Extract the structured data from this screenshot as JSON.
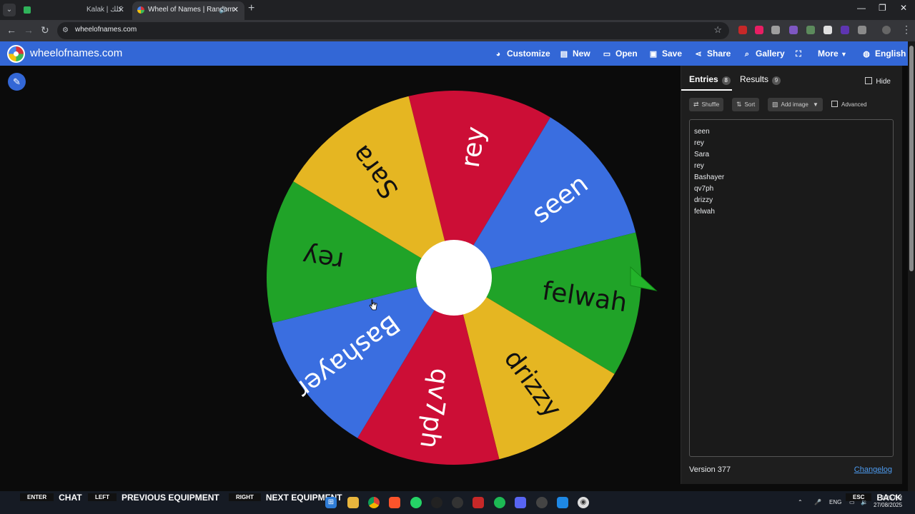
{
  "browser": {
    "tabs": [
      {
        "title": "Kalak | كلك",
        "active": false
      },
      {
        "title": "Wheel of Names | Random",
        "active": true
      }
    ],
    "url": "wheelofnames.com"
  },
  "header": {
    "site_name": "wheelofnames.com",
    "menu": {
      "customize": "Customize",
      "new": "New",
      "open": "Open",
      "save": "Save",
      "share": "Share",
      "gallery": "Gallery",
      "more": "More",
      "language": "English"
    }
  },
  "wheel": {
    "colors": {
      "red": "#cc0e36",
      "blue": "#3a6ee0",
      "green": "#20a328",
      "yellow": "#e5b622"
    },
    "segments": [
      {
        "label": "rey",
        "color": "red"
      },
      {
        "label": "seen",
        "color": "blue"
      },
      {
        "label": "felwah",
        "color": "green"
      },
      {
        "label": "drizzy",
        "color": "yellow"
      },
      {
        "label": "qv7ph",
        "color": "red"
      },
      {
        "label": "Bashayer",
        "color": "blue"
      },
      {
        "label": "rey",
        "color": "green"
      },
      {
        "label": "Sara",
        "color": "yellow"
      }
    ]
  },
  "sidebar": {
    "tab_entries": "Entries",
    "entries_count": "8",
    "tab_results": "Results",
    "results_count": "9",
    "hide": "Hide",
    "shuffle": "Shuffle",
    "sort": "Sort",
    "add_image": "Add image",
    "advanced": "Advanced",
    "entries": [
      "seen",
      "rey",
      "Sara",
      "rey",
      "Bashayer",
      "qv7ph",
      "drizzy",
      "felwah"
    ],
    "version": "Version 377",
    "changelog": "Changelog"
  },
  "overlay": {
    "enter_key": "ENTER",
    "enter_action": "CHAT",
    "left_key": "LEFT",
    "left_action": "PREVIOUS EQUIPMENT",
    "right_key": "RIGHT",
    "right_action": "NEXT EQUIPMENT",
    "esc_key": "ESC",
    "esc_action": "BACK"
  },
  "taskbar": {
    "language": "ENG",
    "time": "1:25 AM",
    "date": "27/08/2025"
  }
}
